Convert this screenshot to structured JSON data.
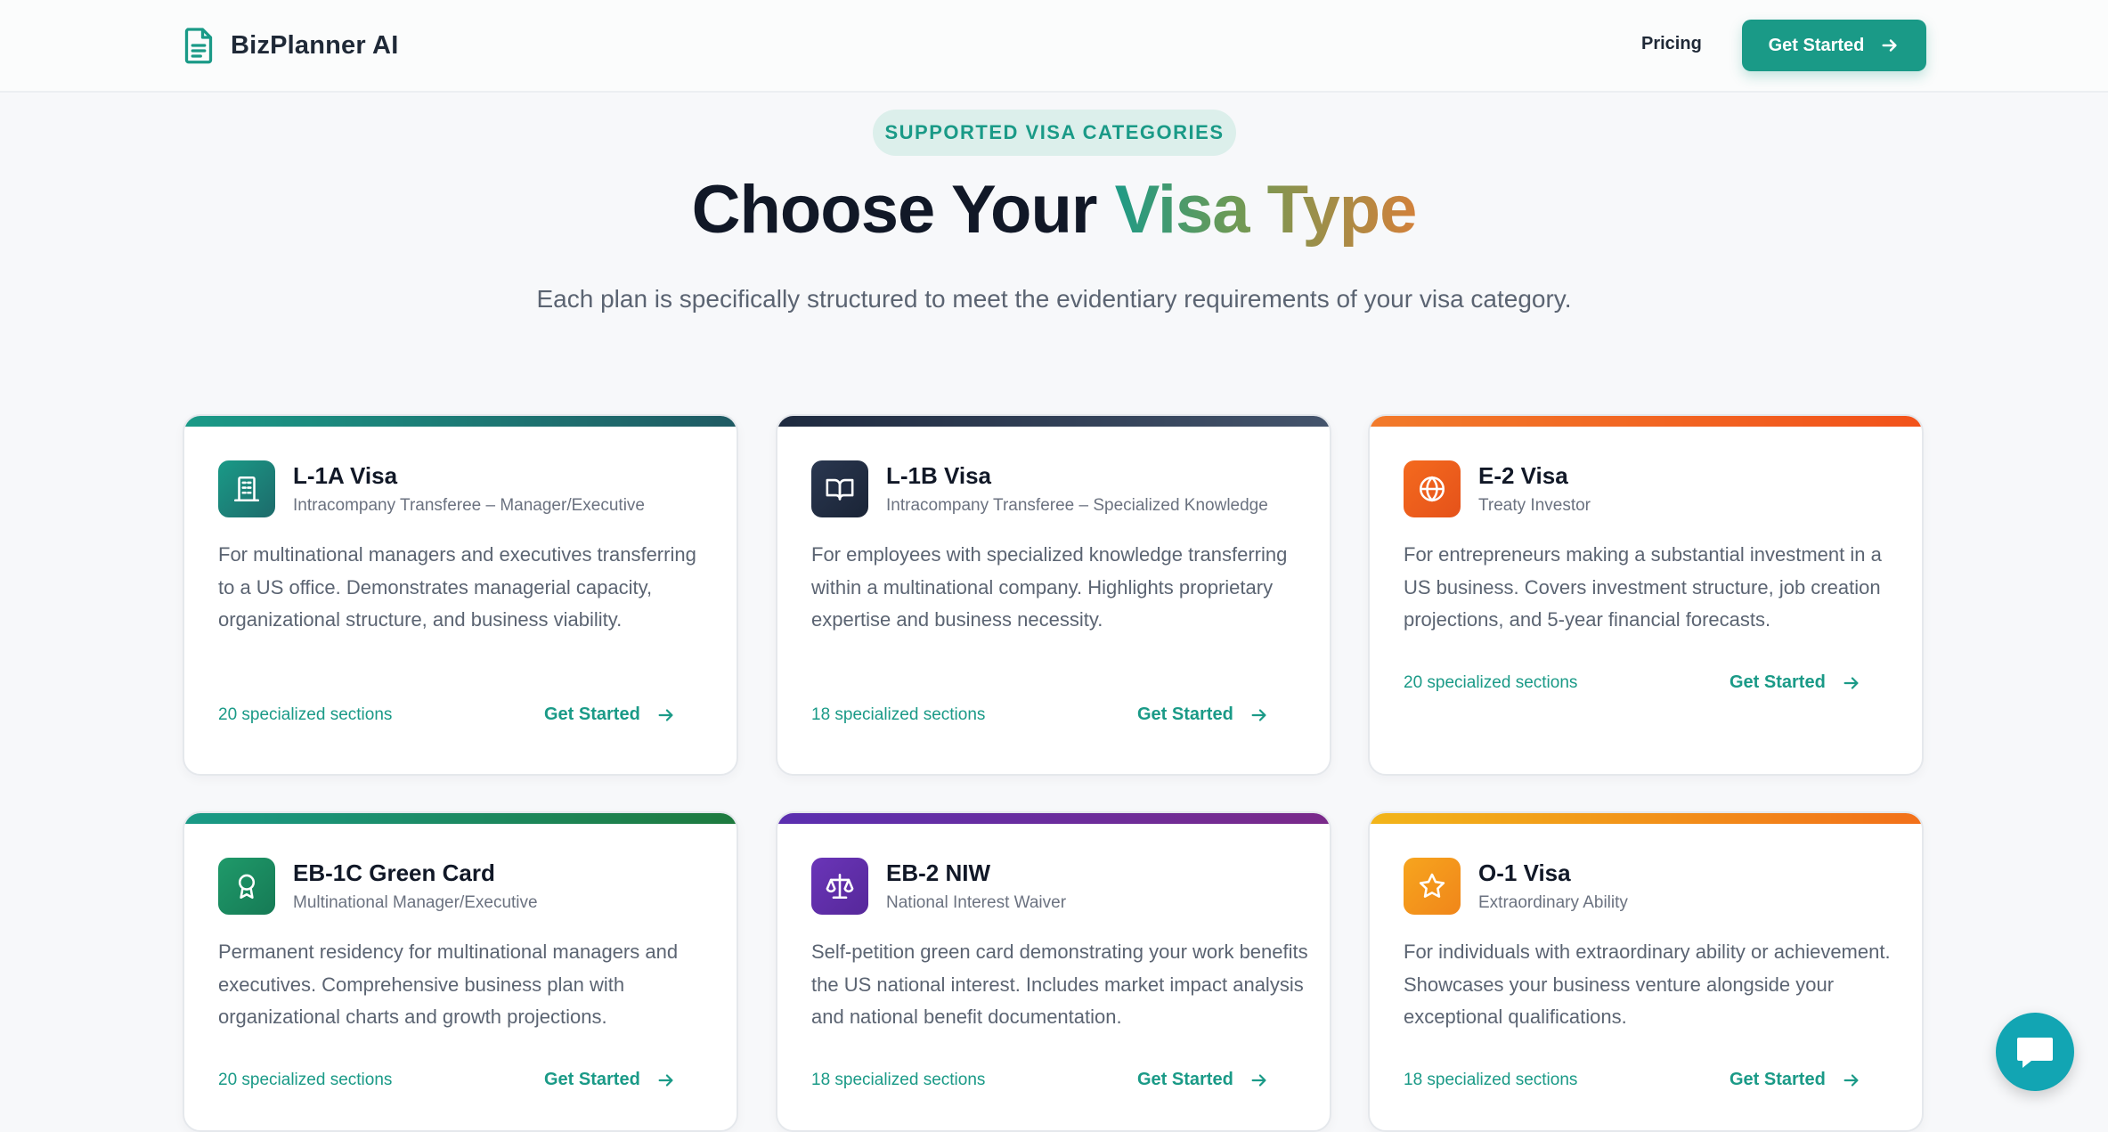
{
  "header": {
    "brand": "BizPlanner AI",
    "nav_pricing": "Pricing",
    "cta_label": "Get Started"
  },
  "hero": {
    "pill": "SUPPORTED VISA CATEGORIES",
    "title_prefix": "Choose Your ",
    "title_accent": "Visa Type",
    "subtitle": "Each plan is specifically structured to meet the evidentiary requirements of your visa category."
  },
  "cards": [
    {
      "title": "L-1A Visa",
      "subtitle": "Intracompany Transferee – Manager/Executive",
      "description": "For multinational managers and executives transferring to a US office. Demonstrates managerial capacity, organizational structure, and business viability.",
      "sections": "20 specialized sections",
      "cta": "Get Started",
      "icon": "building-icon",
      "accent": "#1a8f80"
    },
    {
      "title": "L-1B Visa",
      "subtitle": "Intracompany Transferee – Specialized Knowledge",
      "description": "For employees with specialized knowledge transferring within a multinational company. Highlights proprietary expertise and business necessity.",
      "sections": "18 specialized sections",
      "cta": "Get Started",
      "icon": "book-icon",
      "accent": "#1e2a3f"
    },
    {
      "title": "E-2 Visa",
      "subtitle": "Treaty Investor",
      "description": "For entrepreneurs making a substantial investment in a US business. Covers investment structure, job creation projections, and 5-year financial forecasts.",
      "sections": "20 specialized sections",
      "cta": "Get Started",
      "icon": "globe-icon",
      "accent": "#f2641e"
    },
    {
      "title": "EB-1C Green Card",
      "subtitle": "Multinational Manager/Executive",
      "description": "Permanent residency for multinational managers and executives. Comprehensive business plan with organizational charts and growth projections.",
      "sections": "20 specialized sections",
      "cta": "Get Started",
      "icon": "award-icon",
      "accent": "#1c9068"
    },
    {
      "title": "EB-2 NIW",
      "subtitle": "National Interest Waiver",
      "description": "Self-petition green card demonstrating your work benefits the US national interest. Includes market impact analysis and national benefit documentation.",
      "sections": "18 specialized sections",
      "cta": "Get Started",
      "icon": "scale-icon",
      "accent": "#6a2fb0"
    },
    {
      "title": "O-1 Visa",
      "subtitle": "Extraordinary Ability",
      "description": "For individuals with extraordinary ability or achievement. Showcases your business venture alongside your exceptional qualifications.",
      "sections": "18 specialized sections",
      "cta": "Get Started",
      "icon": "star-icon",
      "accent": "#f59a1a"
    }
  ]
}
